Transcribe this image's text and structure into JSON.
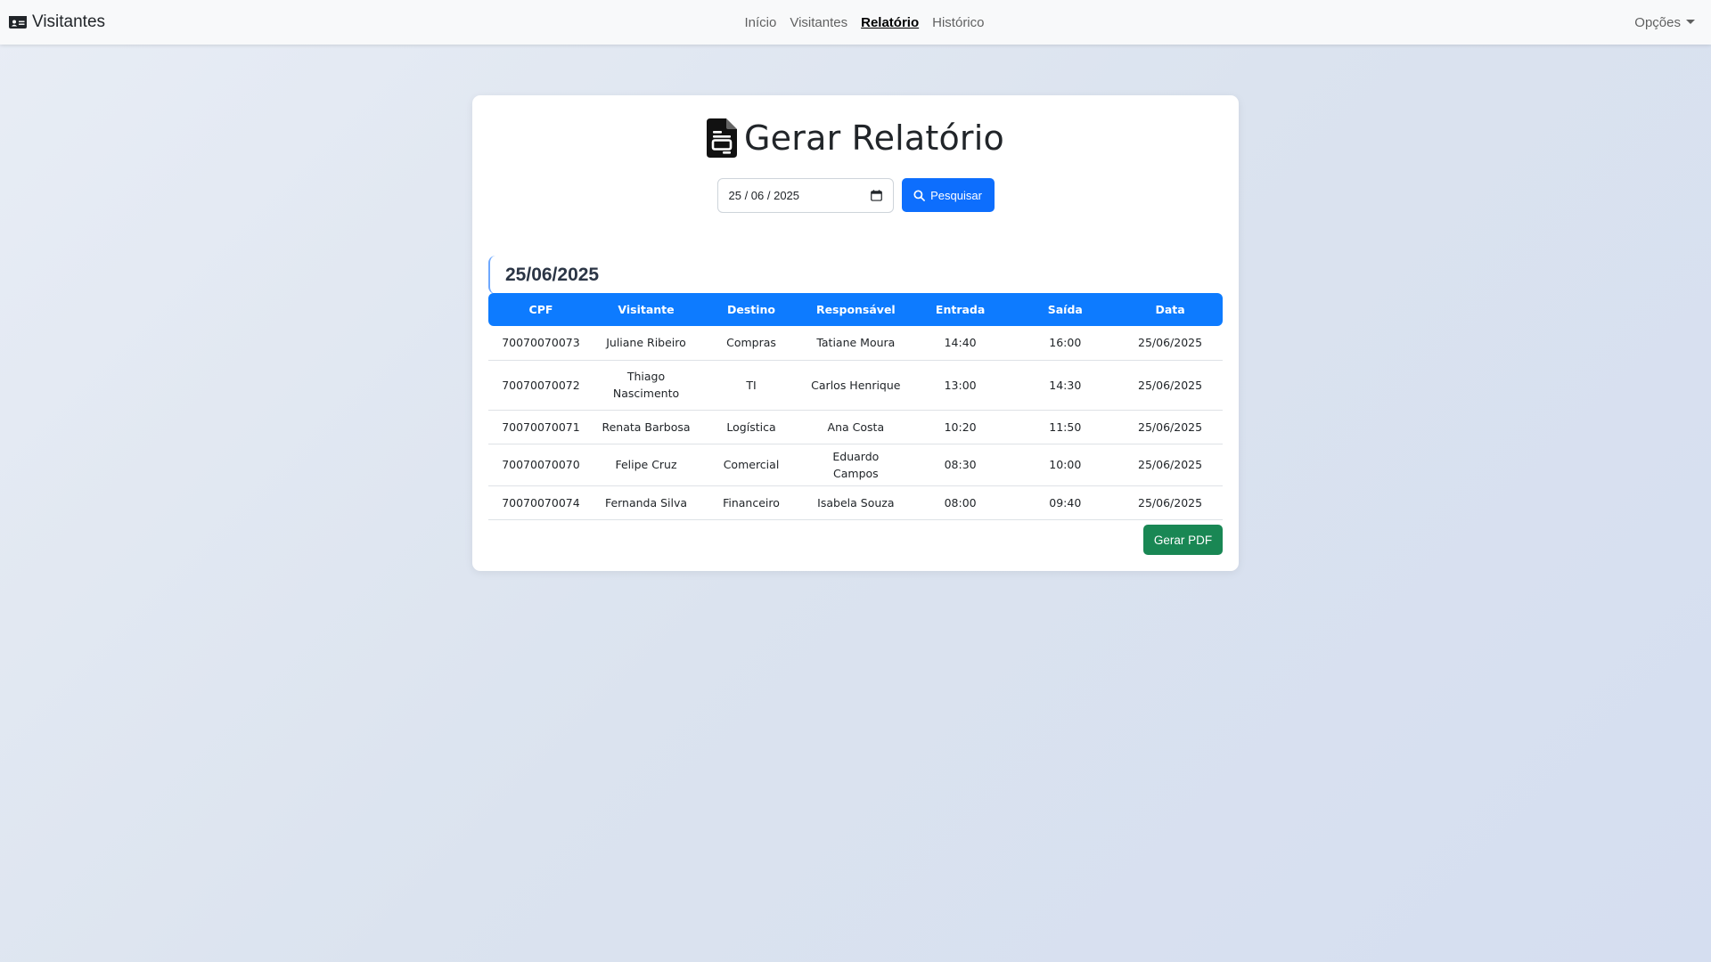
{
  "navbar": {
    "brand": "Visitantes",
    "links": [
      {
        "label": "Início"
      },
      {
        "label": "Visitantes"
      },
      {
        "label": "Relatório"
      },
      {
        "label": "Histórico"
      }
    ],
    "options_label": "Opções"
  },
  "card": {
    "title": "Gerar Relatório",
    "date_input_value": "25 / 06 / 2025",
    "search_label": "Pesquisar",
    "date_heading": "25/06/2025",
    "table": {
      "headers": [
        "CPF",
        "Visitante",
        "Destino",
        "Responsável",
        "Entrada",
        "Saída",
        "Data"
      ],
      "rows": [
        [
          "70070070073",
          "Juliane Ribeiro",
          "Compras",
          "Tatiane Moura",
          "14:40",
          "16:00",
          "25/06/2025"
        ],
        [
          "70070070072",
          "Thiago Nascimento",
          "TI",
          "Carlos Henrique",
          "13:00",
          "14:30",
          "25/06/2025"
        ],
        [
          "70070070071",
          "Renata Barbosa",
          "Logística",
          "Ana Costa",
          "10:20",
          "11:50",
          "25/06/2025"
        ],
        [
          "70070070070",
          "Felipe Cruz",
          "Comercial",
          "Eduardo Campos",
          "08:30",
          "10:00",
          "25/06/2025"
        ],
        [
          "70070070074",
          "Fernanda Silva",
          "Financeiro",
          "Isabela Souza",
          "08:00",
          "09:40",
          "25/06/2025"
        ]
      ]
    },
    "pdf_label": "Gerar PDF"
  },
  "colors": {
    "primary": "#0d6efd",
    "table_header": "#0d7bff",
    "success": "#198754",
    "navbar_bg": "#f8f9fa"
  },
  "icons": {
    "brand": "id-card-icon",
    "title": "file-document-icon",
    "date": "calendar-icon",
    "search": "search-icon",
    "options": "caret-down-icon"
  }
}
